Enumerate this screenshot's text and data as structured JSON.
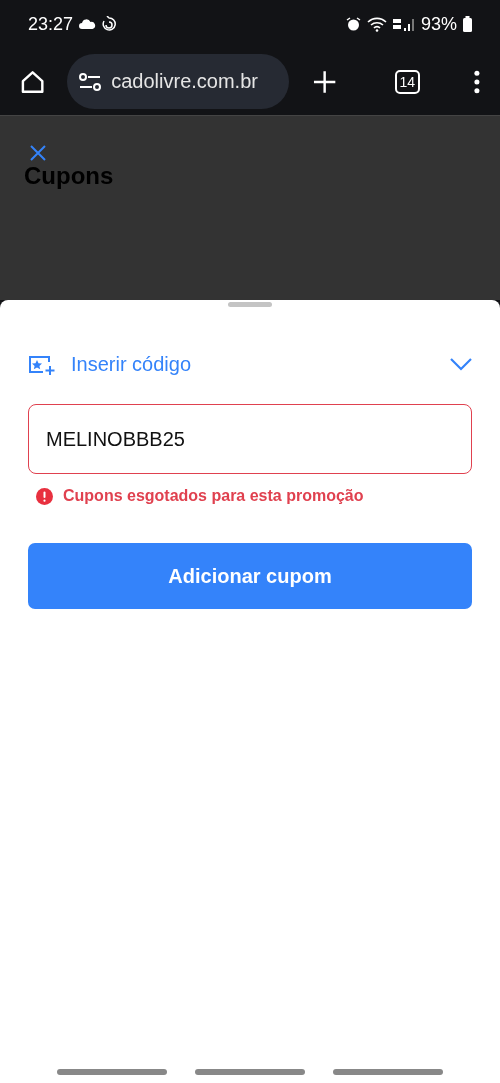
{
  "status_bar": {
    "time": "23:27",
    "battery": "93%"
  },
  "browser": {
    "url": "cadolivre.com.br",
    "tab_count": "14"
  },
  "page": {
    "title": "Cupons"
  },
  "sheet": {
    "section_label": "Inserir código",
    "expanded": true,
    "code_field": {
      "value": "MELINOBBB25",
      "invalid": true
    },
    "error_message": "Cupons esgotados para esta promoção",
    "button": "Adicionar cupom"
  }
}
